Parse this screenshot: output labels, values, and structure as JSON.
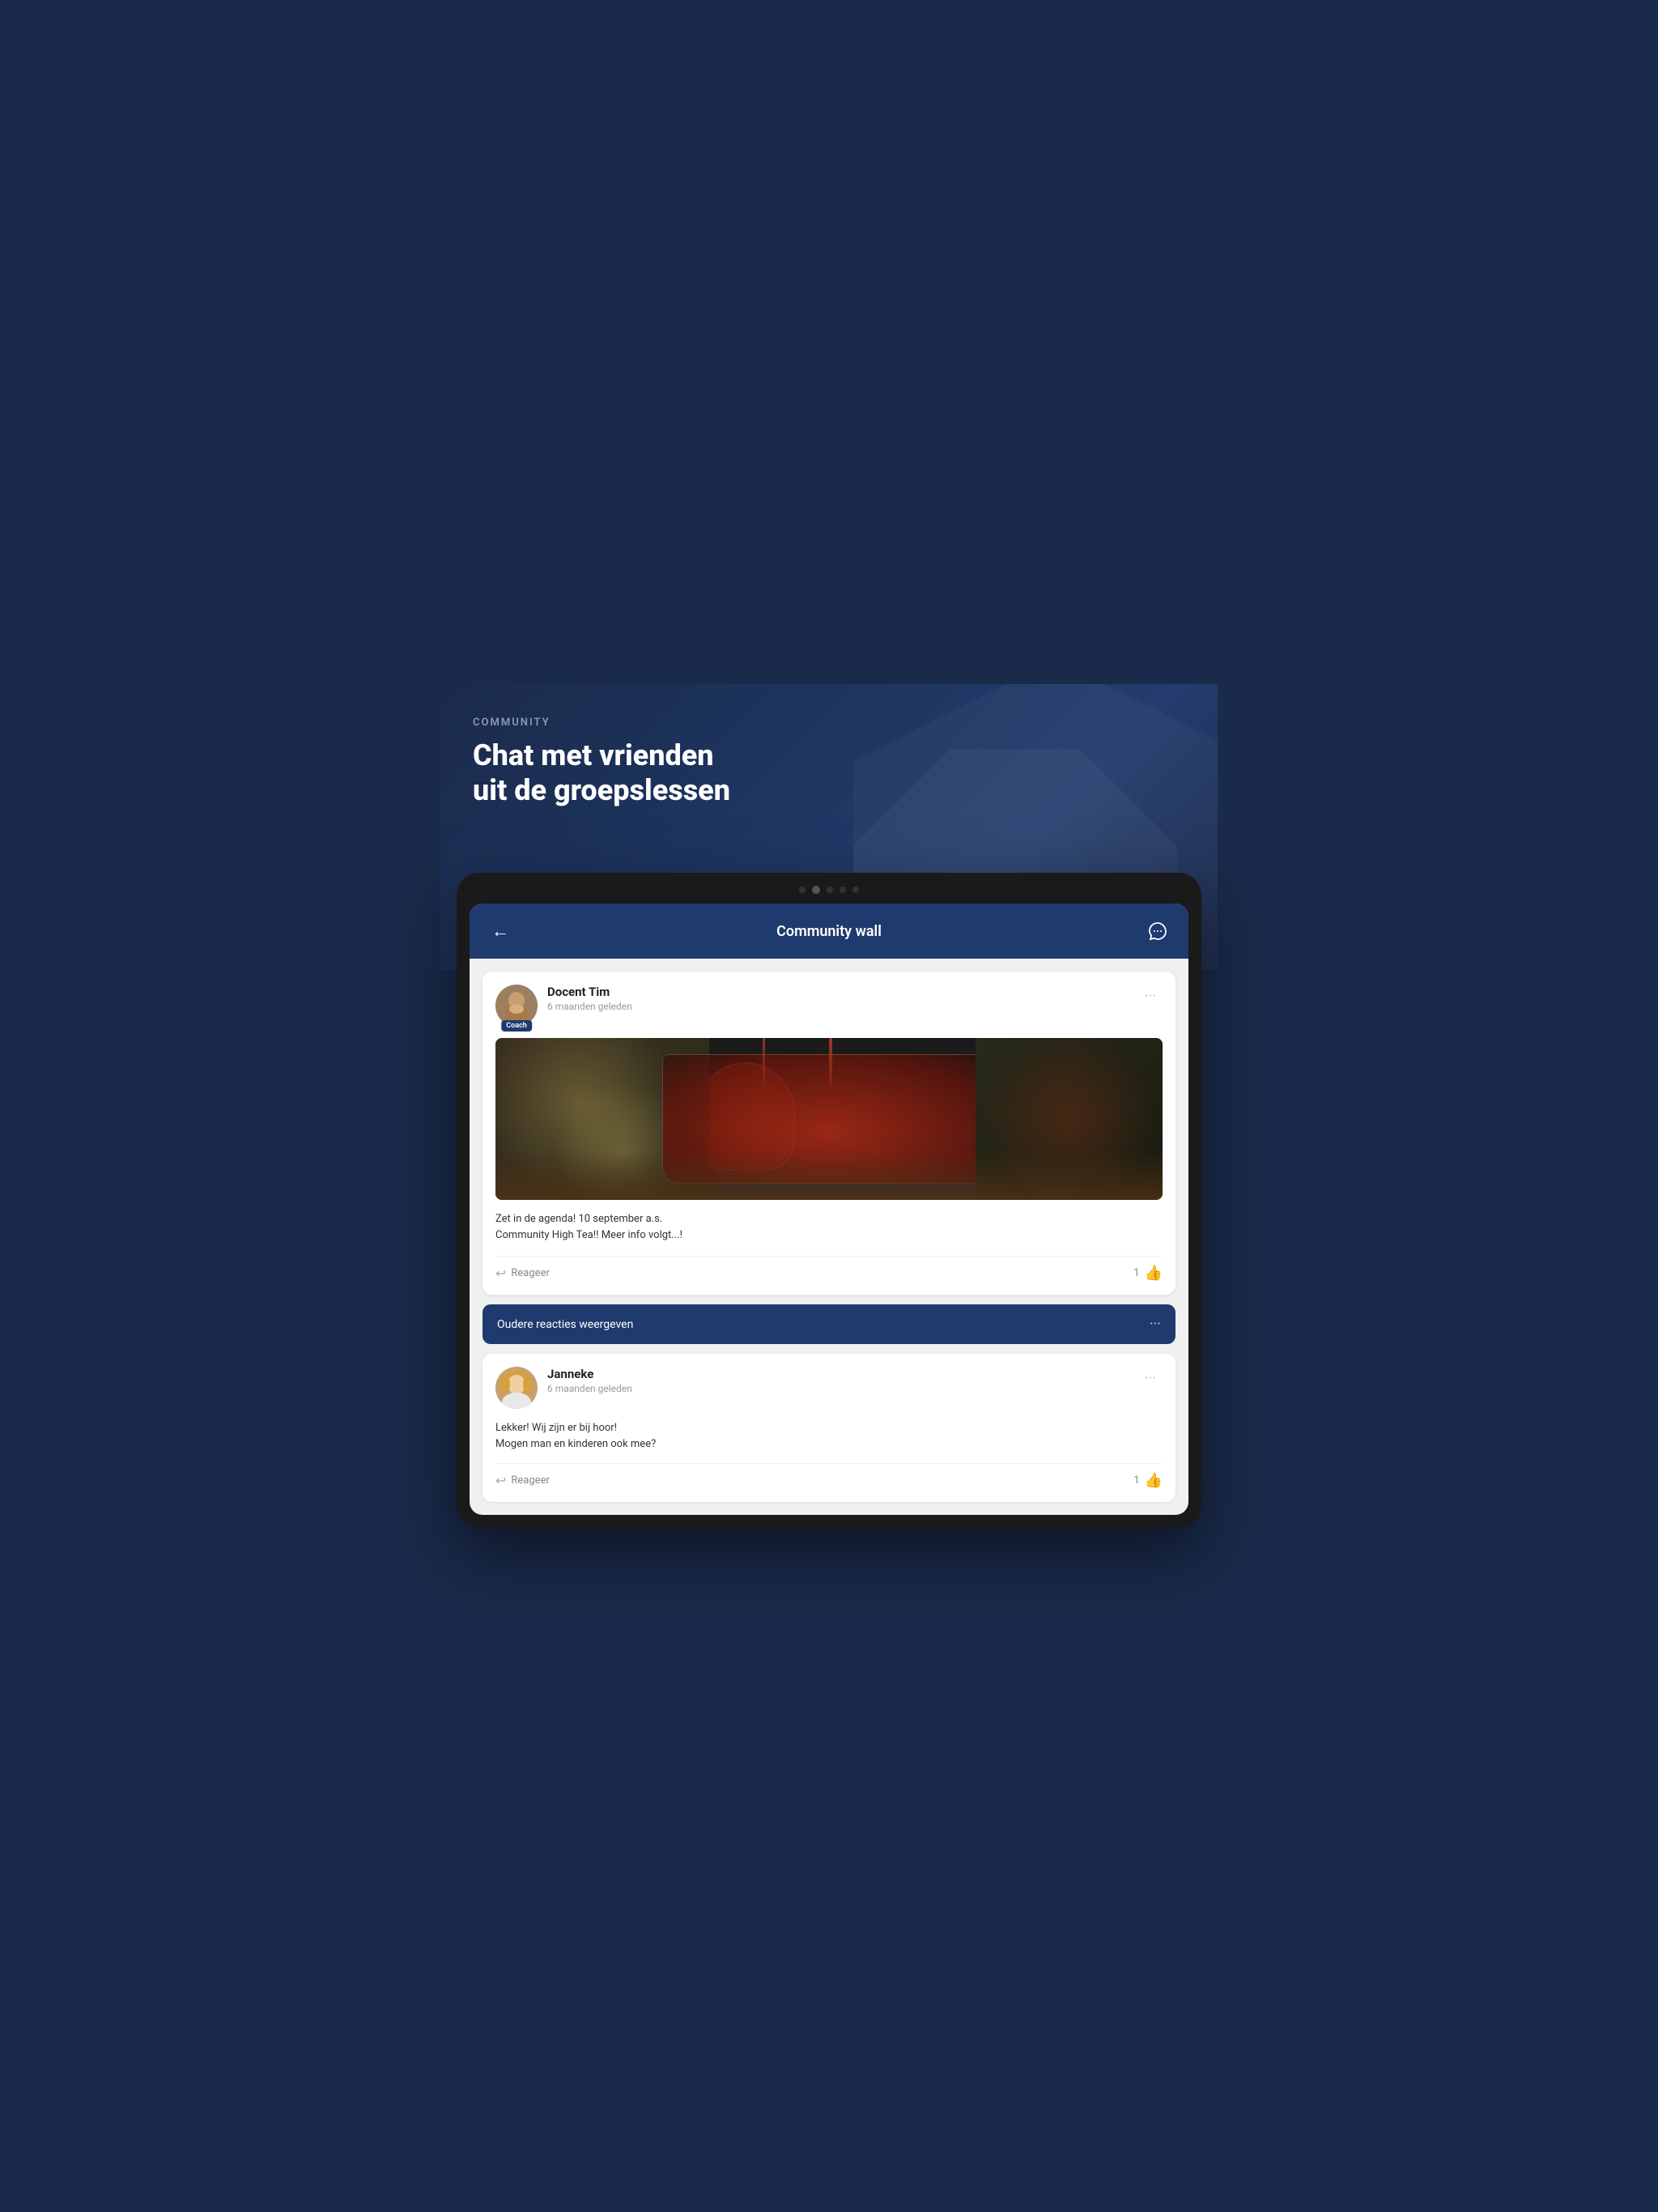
{
  "hero": {
    "section_label": "COMMUNITY",
    "title_line1": "Chat met vrienden",
    "title_line2": "uit de groepslessen"
  },
  "device": {
    "camera_dots": 5
  },
  "header": {
    "title": "Community wall",
    "back_icon": "←",
    "chat_icon": "💬"
  },
  "post": {
    "author_name": "Docent Tim",
    "author_time": "6 maanden geleden",
    "coach_badge": "Coach",
    "options_icon": "···",
    "post_text_line1": "Zet in de agenda! 10 september a.s.",
    "post_text_line2": "Community High Tea!! Meer info volgt...!",
    "reply_label": "Reageer",
    "like_count": "1"
  },
  "older_reactions": {
    "label": "Oudere reacties weergeven",
    "dots": "···"
  },
  "comment": {
    "author_name": "Janneke",
    "author_time": "6 maanden geleden",
    "comment_line1": "Lekker! Wij zijn er bij hoor!",
    "comment_line2": "Mogen man en kinderen ook mee?",
    "reply_label": "Reageer",
    "like_count": "1"
  }
}
